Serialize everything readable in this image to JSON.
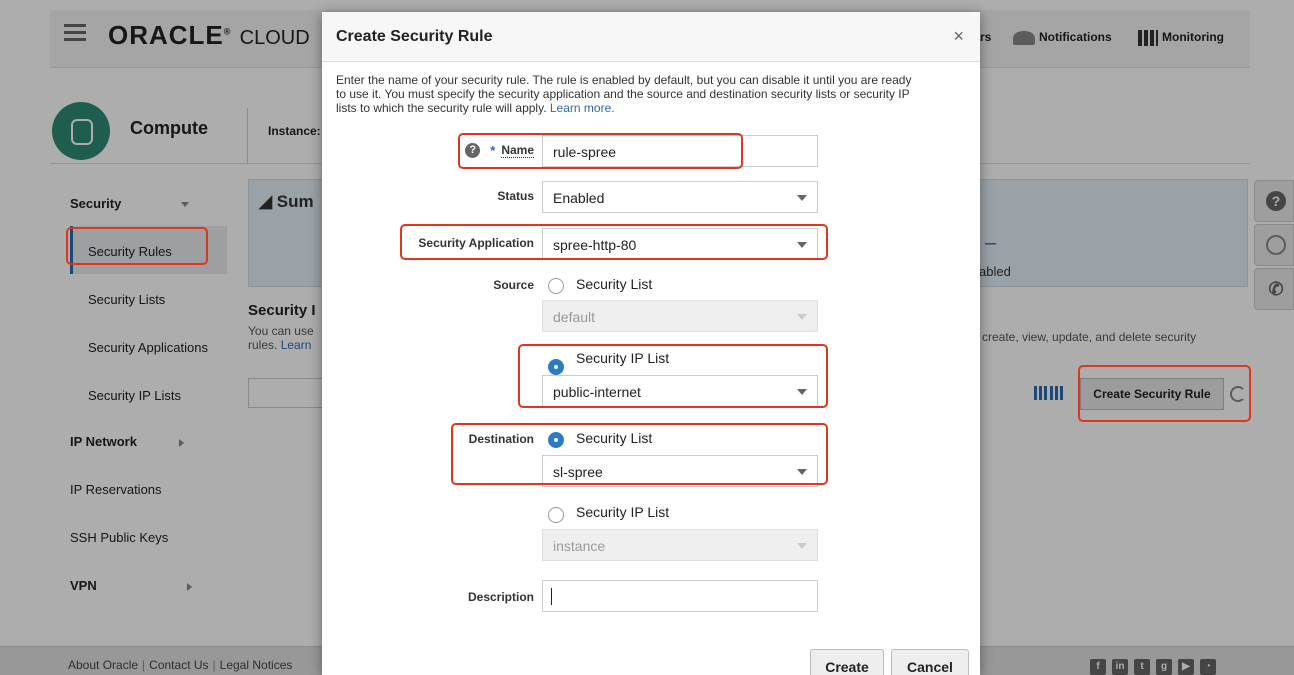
{
  "header": {
    "brand": "ORACLE",
    "brand_suffix": "CLOUD",
    "nav_partial": "rs",
    "notifications": "Notifications",
    "monitoring": "Monitoring"
  },
  "subheader": {
    "title": "Compute",
    "tab_partial": "Instance:"
  },
  "sidebar": {
    "security": "Security",
    "items": [
      "Security Rules",
      "Security Lists",
      "Security Applications",
      "Security IP Lists"
    ],
    "ip_network": "IP Network",
    "ip_reservations": "IP Reservations",
    "ssh_keys": "SSH Public Keys",
    "vpn": "VPN"
  },
  "main": {
    "summary_title": "Sum",
    "summary_dash": "–",
    "summary_enabled": "abled",
    "section_title": "Security I",
    "desc_line1": "You can use",
    "desc_line2": "rules.",
    "desc_link": "Learn",
    "desc_right": "create, view, update, and delete security",
    "create_button": "Create Security Rule"
  },
  "footer": {
    "links": [
      "About Oracle",
      "Contact Us",
      "Legal Notices"
    ],
    "socials": [
      "f",
      "in",
      "t",
      "g+",
      "yt",
      "rss"
    ]
  },
  "dialog": {
    "title": "Create Security Rule",
    "close": "×",
    "intro_line1": "Enter the name of your security rule. The rule is enabled by default, but you can disable it until you are ready",
    "intro_line2": "to use it. You must specify the security application and the source and destination security lists or security IP",
    "intro_line3": "lists to which the security rule will apply.",
    "learn_more": "Learn more.",
    "name_label": "Name",
    "name_value": "rule-spree",
    "status_label": "Status",
    "status_value": "Enabled",
    "app_label": "Security Application",
    "app_value": "spree-http-80",
    "source_label": "Source",
    "source_opt1": "Security List",
    "source_list_value": "default",
    "source_opt2": "Security IP List",
    "source_ip_value": "public-internet",
    "dest_label": "Destination",
    "dest_opt1": "Security List",
    "dest_list_value": "sl-spree",
    "dest_opt2": "Security IP List",
    "dest_ip_value": "instance",
    "desc_label": "Description",
    "desc_value": "",
    "create": "Create",
    "cancel": "Cancel"
  },
  "colors": {
    "accent": "#2c6ab0",
    "highlight": "#e0351f",
    "compute": "#2e8b73"
  }
}
